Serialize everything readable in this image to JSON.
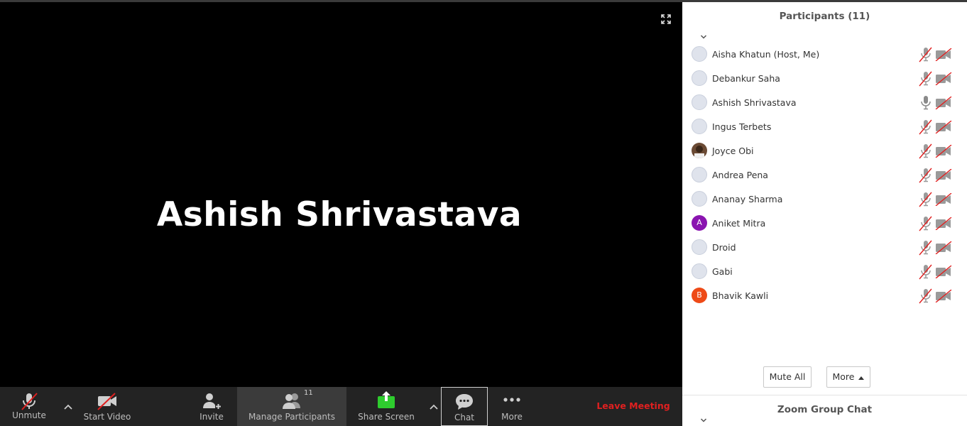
{
  "video": {
    "speaker_name": "Ashish Shrivastava"
  },
  "toolbar": {
    "unmute_label": "Unmute",
    "start_video_label": "Start Video",
    "invite_label": "Invite",
    "manage_participants_label": "Manage Participants",
    "participant_count": "11",
    "share_screen_label": "Share Screen",
    "chat_label": "Chat",
    "more_label": "More",
    "leave_label": "Leave Meeting",
    "share_color": "#2ecc2e",
    "leave_color": "#e02020"
  },
  "panel": {
    "title": "Participants (11)",
    "participants": [
      {
        "name": "Aisha Khatun (Host, Me)",
        "avatar": "default",
        "mic": "muted",
        "video": "off"
      },
      {
        "name": "Debankur Saha",
        "avatar": "default",
        "mic": "muted",
        "video": "off"
      },
      {
        "name": "Ashish Shrivastava",
        "avatar": "default",
        "mic": "on",
        "video": "off"
      },
      {
        "name": "Ingus Terbets",
        "avatar": "default",
        "mic": "muted",
        "video": "off"
      },
      {
        "name": "Joyce Obi",
        "avatar": "photo",
        "mic": "muted",
        "video": "off"
      },
      {
        "name": "Andrea Pena",
        "avatar": "default",
        "mic": "muted",
        "video": "off"
      },
      {
        "name": "Ananay Sharma",
        "avatar": "default",
        "mic": "muted",
        "video": "off"
      },
      {
        "name": "Aniket Mitra",
        "avatar": "letter",
        "letter": "A",
        "avatar_color": "#8a14b0",
        "mic": "muted",
        "video": "off"
      },
      {
        "name": "Droid",
        "avatar": "default",
        "mic": "muted",
        "video": "off"
      },
      {
        "name": "Gabi",
        "avatar": "default",
        "mic": "muted",
        "video": "off"
      },
      {
        "name": "Bhavik Kawli",
        "avatar": "letter",
        "letter": "B",
        "avatar_color": "#ee4a17",
        "mic": "muted",
        "video": "off"
      }
    ],
    "mute_all_label": "Mute All",
    "more_label": "More",
    "group_chat_title": "Zoom Group Chat"
  }
}
